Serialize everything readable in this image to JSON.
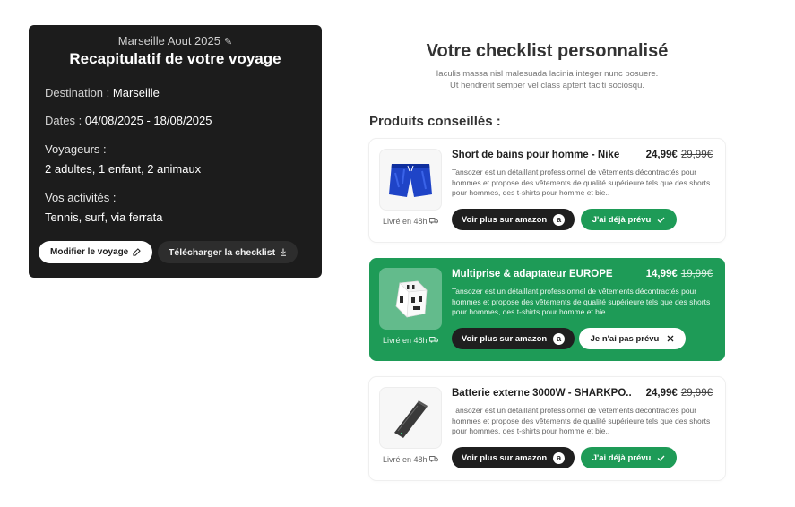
{
  "recap": {
    "subtitle": "Marseille Aout 2025",
    "title": "Recapitulatif de votre voyage",
    "destination_label": "Destination :",
    "destination_value": "Marseille",
    "dates_label": "Dates :",
    "dates_value": "04/08/2025 - 18/08/2025",
    "travelers_label": "Voyageurs :",
    "travelers_value": "2 adultes, 1 enfant, 2 animaux",
    "activities_label": "Vos activités :",
    "activities_value": "Tennis, surf, via ferrata",
    "edit_button": "Modifier le voyage",
    "download_button": "Télécharger la checklist"
  },
  "checklist": {
    "title": "Votre checklist personnalisé",
    "description_line1": "Iaculis massa nisl malesuada lacinia integer nunc posuere.",
    "description_line2": "Ut hendrerit semper vel class aptent taciti sociosqu.",
    "section_title": "Produits conseillés :"
  },
  "products": [
    {
      "name": "Short de bains pour homme - Nike",
      "price": "24,99€",
      "old_price": "29,99€",
      "description": "Tansozer est un détaillant professionnel de vêtements décontractés pour hommes et propose des vêtements de qualité supérieure tels que des shorts pour hommes, des t-shirts pour homme et bie..",
      "delivery": "Livré en 48h",
      "amazon_button": "Voir plus sur amazon",
      "status_button": "J'ai déjà prévu",
      "selected": false
    },
    {
      "name": "Multiprise & adaptateur EUROPE",
      "price": "14,99€",
      "old_price": "19,99€",
      "description": "Tansozer est un détaillant professionnel de vêtements décontractés pour hommes et propose des vêtements de qualité supérieure tels que des shorts pour hommes, des t-shirts pour homme et bie..",
      "delivery": "Livré en 48h",
      "amazon_button": "Voir plus sur amazon",
      "status_button": "Je n'ai pas prévu",
      "selected": true
    },
    {
      "name": "Batterie externe 3000W - SHARKPO..",
      "price": "24,99€",
      "old_price": "29,99€",
      "description": "Tansozer est un détaillant professionnel de vêtements décontractés pour hommes et propose des vêtements de qualité supérieure tels que des shorts pour hommes, des t-shirts pour homme et bie..",
      "delivery": "Livré en 48h",
      "amazon_button": "Voir plus sur amazon",
      "status_button": "J'ai déjà prévu",
      "selected": false
    }
  ],
  "icons": {
    "edit": "edit-icon",
    "download": "download-icon",
    "amazon": "amazon-icon",
    "check": "check-icon",
    "close": "close-icon",
    "truck": "truck-icon"
  },
  "colors": {
    "accent_green": "#1e9b57",
    "dark_card": "#1c1c1c"
  }
}
